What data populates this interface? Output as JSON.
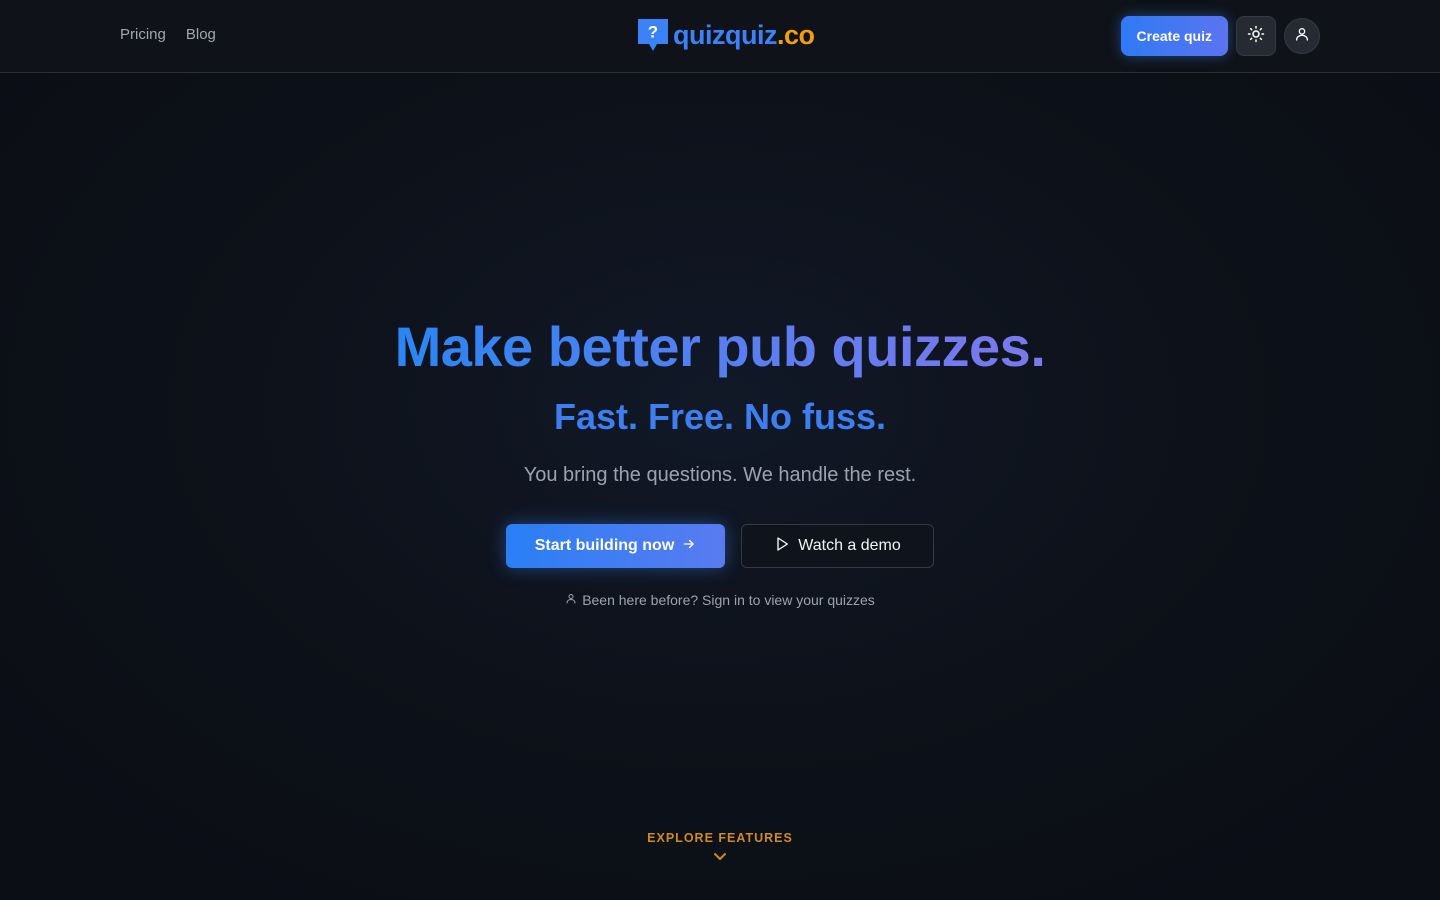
{
  "nav": {
    "links": [
      "Pricing",
      "Blog"
    ]
  },
  "logo": {
    "mark_glyph": "?",
    "text_main": "quizquiz",
    "text_tld": ".co"
  },
  "header": {
    "create_label": "Create quiz",
    "theme_icon": "sun-icon",
    "user_icon": "user-icon"
  },
  "hero": {
    "title": "Make better pub quizzes.",
    "subtitle": "Fast. Free. No fuss.",
    "description": "You bring the questions. We handle the rest.",
    "primary_cta": "Start building now",
    "secondary_cta": "Watch a demo",
    "signin_text": "Been here before? Sign in to view your quizzes"
  },
  "explore": {
    "label": "EXPLORE FEATURES",
    "icon": "chevron-down-icon"
  },
  "colors": {
    "brand_blue": "#3b82f6",
    "brand_orange": "#f59e0b",
    "accent_gradient_end": "#7d78ee",
    "explore_label": "#d08a1f"
  }
}
